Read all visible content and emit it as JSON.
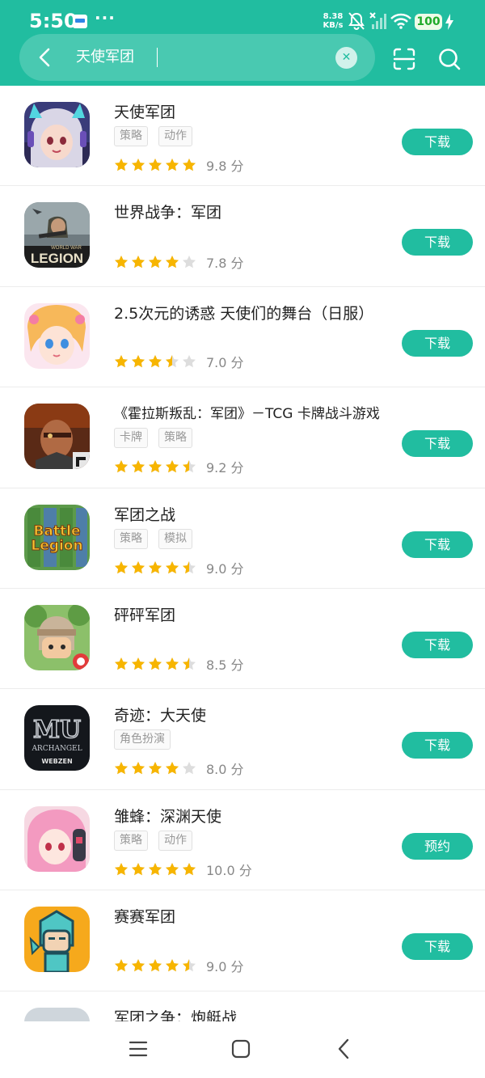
{
  "status_bar": {
    "time": "5:50",
    "more": "···",
    "net_speed_value": "8.38",
    "net_speed_unit": "KB/s",
    "battery": "100"
  },
  "search": {
    "query": "天使军团"
  },
  "apps": [
    {
      "name": "天使军团",
      "tags": [
        "策略",
        "动作"
      ],
      "stars": 5,
      "score": "9.8 分",
      "button": "下载"
    },
    {
      "name": "世界战争：军团",
      "tags": [],
      "stars": 4,
      "score": "7.8 分",
      "button": "下载"
    },
    {
      "name": "2.5次元的诱惑 天使们的舞台（日服）",
      "tags": [],
      "stars": 3.5,
      "score": "7.0 分",
      "button": "下载"
    },
    {
      "name": "《霍拉斯叛乱：军团》－TCG 卡牌战斗游戏",
      "tags": [
        "卡牌",
        "策略"
      ],
      "stars": 4.5,
      "score": "9.2 分",
      "button": "下载"
    },
    {
      "name": "军团之战",
      "tags": [
        "策略",
        "模拟"
      ],
      "stars": 4.5,
      "score": "9.0 分",
      "button": "下载"
    },
    {
      "name": "砰砰军团",
      "tags": [],
      "stars": 4.5,
      "score": "8.5 分",
      "button": "下载"
    },
    {
      "name": "奇迹：大天使",
      "tags": [
        "角色扮演"
      ],
      "stars": 4,
      "score": "8.0 分",
      "button": "下载"
    },
    {
      "name": "雏蜂：深渊天使",
      "tags": [
        "策略",
        "动作"
      ],
      "stars": 5,
      "score": "10.0 分",
      "button": "预约"
    },
    {
      "name": "赛赛军团",
      "tags": [],
      "stars": 4.5,
      "score": "9.0 分",
      "button": "下载"
    },
    {
      "name": "军团之争：炮艇战",
      "tags": [],
      "stars": null,
      "score": null,
      "button": null
    }
  ],
  "icon_text": {
    "legion_top": "WORLD WAR",
    "legion_main": "LEGION",
    "battle_legion_1": "Battle",
    "battle_legion_2": "Legion",
    "mu_main": "MU",
    "mu_sub": "ARCHANGEL",
    "mu_brand": "WEBZEN"
  },
  "colors": {
    "accent": "#21bda0",
    "star": "#f7b500",
    "star_empty": "#dddddd"
  }
}
